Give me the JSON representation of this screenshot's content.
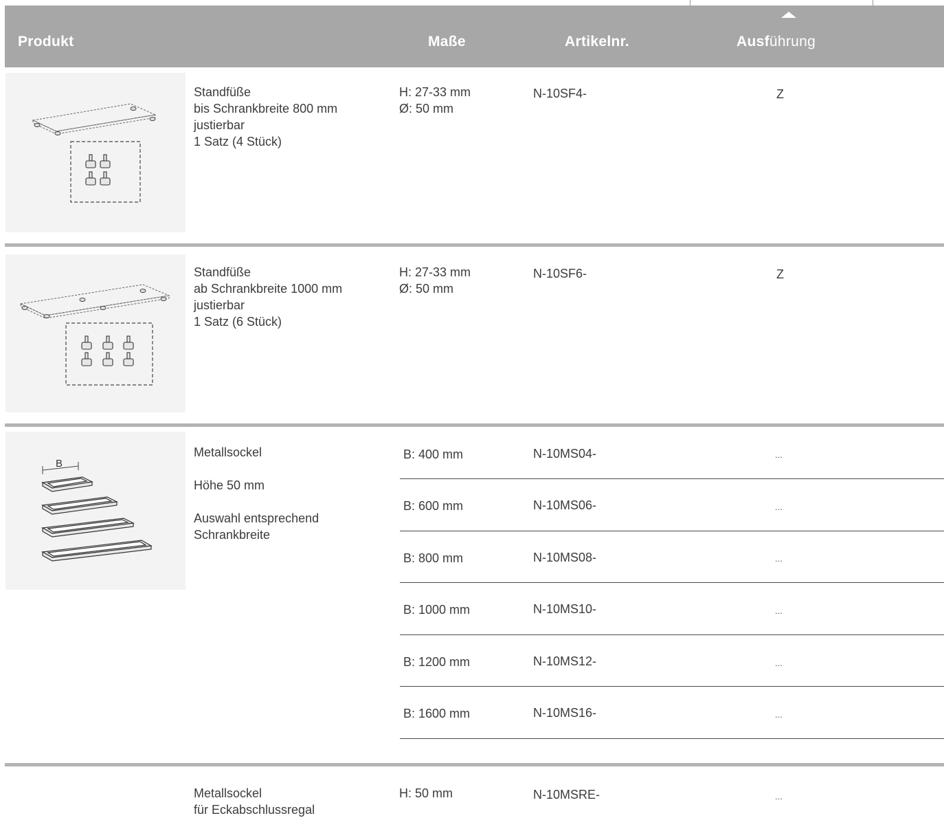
{
  "header": {
    "produkt": "Produkt",
    "masse": "Maße",
    "artikelnr": "Artikelnr.",
    "ausfuehrung_bold": "Ausf",
    "ausfuehrung_light": "ührung"
  },
  "products": [
    {
      "lines": [
        "Standfüße",
        "bis Schrankbreite 800 mm",
        "justierbar",
        "1 Satz (4 Stück)"
      ],
      "masse": [
        "H: 27-33 mm",
        "Ø: 50 mm"
      ],
      "artikelnr": "N-10SF4-",
      "ausfuehrung": "Z"
    },
    {
      "lines": [
        "Standfüße",
        "ab Schrankbreite 1000 mm",
        "justierbar",
        "1 Satz (6 Stück)"
      ],
      "masse": [
        "H: 27-33 mm",
        "Ø: 50 mm"
      ],
      "artikelnr": "N-10SF6-",
      "ausfuehrung": "Z"
    },
    {
      "title": "Metallsockel",
      "height_note": "Höhe 50 mm",
      "choice_lines": [
        "Auswahl entsprechend",
        "Schrankbreite"
      ],
      "drawing_label": "B",
      "variants": [
        {
          "masse": "B: 400 mm",
          "artikelnr": "N-10MS04-",
          "ausfuehrung": "..."
        },
        {
          "masse": "B: 600 mm",
          "artikelnr": "N-10MS06-",
          "ausfuehrung": "..."
        },
        {
          "masse": "B: 800 mm",
          "artikelnr": "N-10MS08-",
          "ausfuehrung": "..."
        },
        {
          "masse": "B: 1000 mm",
          "artikelnr": "N-10MS10-",
          "ausfuehrung": "..."
        },
        {
          "masse": "B: 1200 mm",
          "artikelnr": "N-10MS12-",
          "ausfuehrung": "..."
        },
        {
          "masse": "B: 1600 mm",
          "artikelnr": "N-10MS16-",
          "ausfuehrung": "..."
        }
      ]
    },
    {
      "lines": [
        "Metallsockel",
        "für Eckabschlussregal"
      ],
      "masse": [
        "H: 50 mm"
      ],
      "artikelnr": "N-10MSRE-",
      "ausfuehrung": "..."
    }
  ]
}
